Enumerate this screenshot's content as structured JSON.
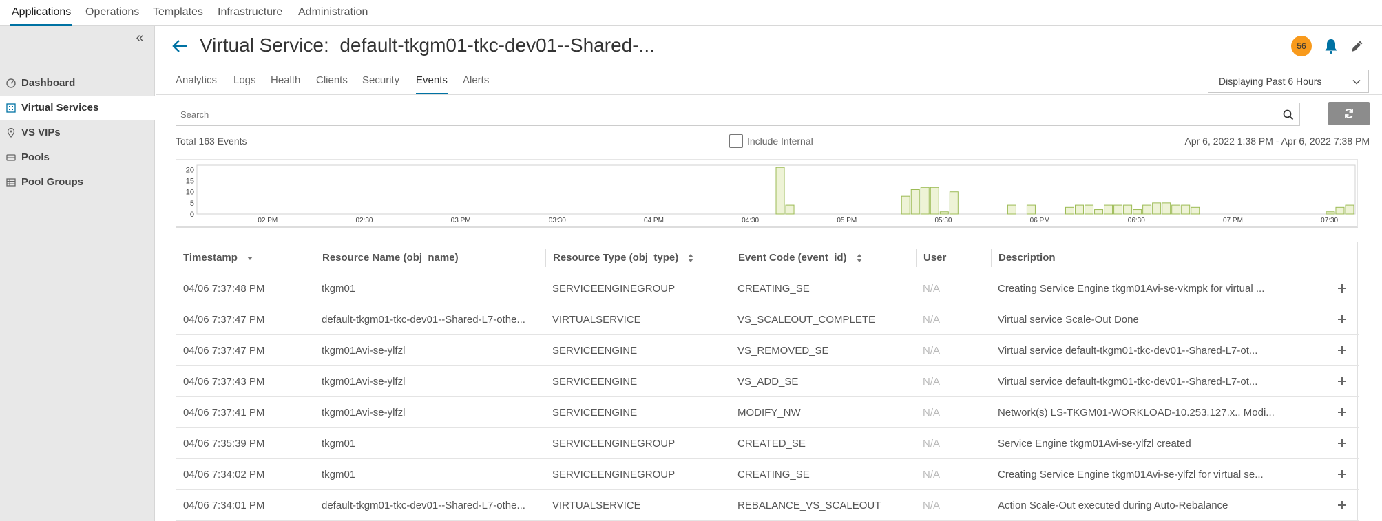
{
  "topnav": {
    "tabs": [
      {
        "label": "Applications",
        "active": true
      },
      {
        "label": "Operations",
        "active": false
      },
      {
        "label": "Templates",
        "active": false
      },
      {
        "label": "Infrastructure",
        "active": false
      },
      {
        "label": "Administration",
        "active": false
      }
    ]
  },
  "sidebar": {
    "collapse_icon": "double-chevron-left-icon",
    "items": [
      {
        "label": "Dashboard",
        "icon": "dashboard-icon",
        "active": false
      },
      {
        "label": "Virtual Services",
        "icon": "virtual-services-icon",
        "active": true
      },
      {
        "label": "VS VIPs",
        "icon": "location-pin-icon",
        "active": false
      },
      {
        "label": "Pools",
        "icon": "pool-icon",
        "active": false
      },
      {
        "label": "Pool Groups",
        "icon": "pool-groups-icon",
        "active": false
      }
    ]
  },
  "header": {
    "title": "Virtual Service:  default-tkgm01-tkc-dev01--Shared-...",
    "alert_count": "56",
    "accent_color": "#0072a3",
    "badge_color": "#f89a1c"
  },
  "subtabs": [
    {
      "label": "Analytics",
      "active": false
    },
    {
      "label": "Logs",
      "active": false
    },
    {
      "label": "Health",
      "active": false
    },
    {
      "label": "Clients",
      "active": false
    },
    {
      "label": "Security",
      "active": false
    },
    {
      "label": "Events",
      "active": true
    },
    {
      "label": "Alerts",
      "active": false
    }
  ],
  "time_selector": {
    "value": "Displaying Past 6 Hours"
  },
  "search": {
    "placeholder": "Search",
    "value": ""
  },
  "summary": {
    "total": "Total 163 Events",
    "include_internal": "Include Internal",
    "include_internal_checked": false,
    "range": "Apr 6, 2022 1:38 PM - Apr 6, 2022 7:38 PM"
  },
  "chart_data": {
    "type": "bar",
    "color": "#eef3d6",
    "stroke": "#9cbb55",
    "ylim": [
      0,
      22
    ],
    "yticks": [
      "20",
      "15",
      "10",
      "5",
      "0"
    ],
    "ytick_values": [
      20,
      15,
      10,
      5,
      0
    ],
    "xlim": [
      0,
      360
    ],
    "xticks": [
      "02 PM",
      "02:30",
      "03 PM",
      "03:30",
      "04 PM",
      "04:30",
      "05 PM",
      "05:30",
      "06 PM",
      "06:30",
      "07 PM",
      "07:30"
    ],
    "xtick_values": [
      22,
      52,
      82,
      112,
      142,
      172,
      202,
      232,
      262,
      292,
      322,
      352
    ],
    "bars": [
      {
        "t": 180,
        "v": 21
      },
      {
        "t": 183,
        "v": 4
      },
      {
        "t": 219,
        "v": 8
      },
      {
        "t": 222,
        "v": 11
      },
      {
        "t": 225,
        "v": 12
      },
      {
        "t": 228,
        "v": 12
      },
      {
        "t": 231,
        "v": 1
      },
      {
        "t": 234,
        "v": 10
      },
      {
        "t": 252,
        "v": 4
      },
      {
        "t": 258,
        "v": 4
      },
      {
        "t": 270,
        "v": 3
      },
      {
        "t": 273,
        "v": 4
      },
      {
        "t": 276,
        "v": 4
      },
      {
        "t": 279,
        "v": 2
      },
      {
        "t": 282,
        "v": 4
      },
      {
        "t": 285,
        "v": 4
      },
      {
        "t": 288,
        "v": 4
      },
      {
        "t": 291,
        "v": 2
      },
      {
        "t": 294,
        "v": 4
      },
      {
        "t": 297,
        "v": 5
      },
      {
        "t": 300,
        "v": 5
      },
      {
        "t": 303,
        "v": 4
      },
      {
        "t": 306,
        "v": 4
      },
      {
        "t": 309,
        "v": 3
      },
      {
        "t": 351,
        "v": 1
      },
      {
        "t": 354,
        "v": 3
      },
      {
        "t": 357,
        "v": 4
      }
    ]
  },
  "table": {
    "columns": [
      {
        "label": "Timestamp",
        "sort": "desc"
      },
      {
        "label": "Resource Name (obj_name)",
        "sort": "none"
      },
      {
        "label": "Resource Type (obj_type)",
        "sort": "both"
      },
      {
        "label": "Event Code (event_id)",
        "sort": "both"
      },
      {
        "label": "User",
        "sort": "none"
      },
      {
        "label": "Description",
        "sort": "none"
      }
    ],
    "rows": [
      [
        "04/06 7:37:48 PM",
        "tkgm01",
        "SERVICEENGINEGROUP",
        "CREATING_SE",
        "N/A",
        "Creating Service Engine tkgm01Avi-se-vkmpk for virtual ..."
      ],
      [
        "04/06 7:37:47 PM",
        "default-tkgm01-tkc-dev01--Shared-L7-othe...",
        "VIRTUALSERVICE",
        "VS_SCALEOUT_COMPLETE",
        "N/A",
        "Virtual service Scale-Out Done"
      ],
      [
        "04/06 7:37:47 PM",
        "tkgm01Avi-se-ylfzl",
        "SERVICEENGINE",
        "VS_REMOVED_SE",
        "N/A",
        "Virtual service default-tkgm01-tkc-dev01--Shared-L7-ot..."
      ],
      [
        "04/06 7:37:43 PM",
        "tkgm01Avi-se-ylfzl",
        "SERVICEENGINE",
        "VS_ADD_SE",
        "N/A",
        "Virtual service default-tkgm01-tkc-dev01--Shared-L7-ot..."
      ],
      [
        "04/06 7:37:41 PM",
        "tkgm01Avi-se-ylfzl",
        "SERVICEENGINE",
        "MODIFY_NW",
        "N/A",
        "Network(s) LS-TKGM01-WORKLOAD-10.253.127.x.. Modi..."
      ],
      [
        "04/06 7:35:39 PM",
        "tkgm01",
        "SERVICEENGINEGROUP",
        "CREATED_SE",
        "N/A",
        "Service Engine tkgm01Avi-se-ylfzl created"
      ],
      [
        "04/06 7:34:02 PM",
        "tkgm01",
        "SERVICEENGINEGROUP",
        "CREATING_SE",
        "N/A",
        "Creating Service Engine tkgm01Avi-se-ylfzl for virtual se..."
      ],
      [
        "04/06 7:34:01 PM",
        "default-tkgm01-tkc-dev01--Shared-L7-othe...",
        "VIRTUALSERVICE",
        "REBALANCE_VS_SCALEOUT",
        "N/A",
        "Action Scale-Out executed during Auto-Rebalance"
      ]
    ]
  }
}
